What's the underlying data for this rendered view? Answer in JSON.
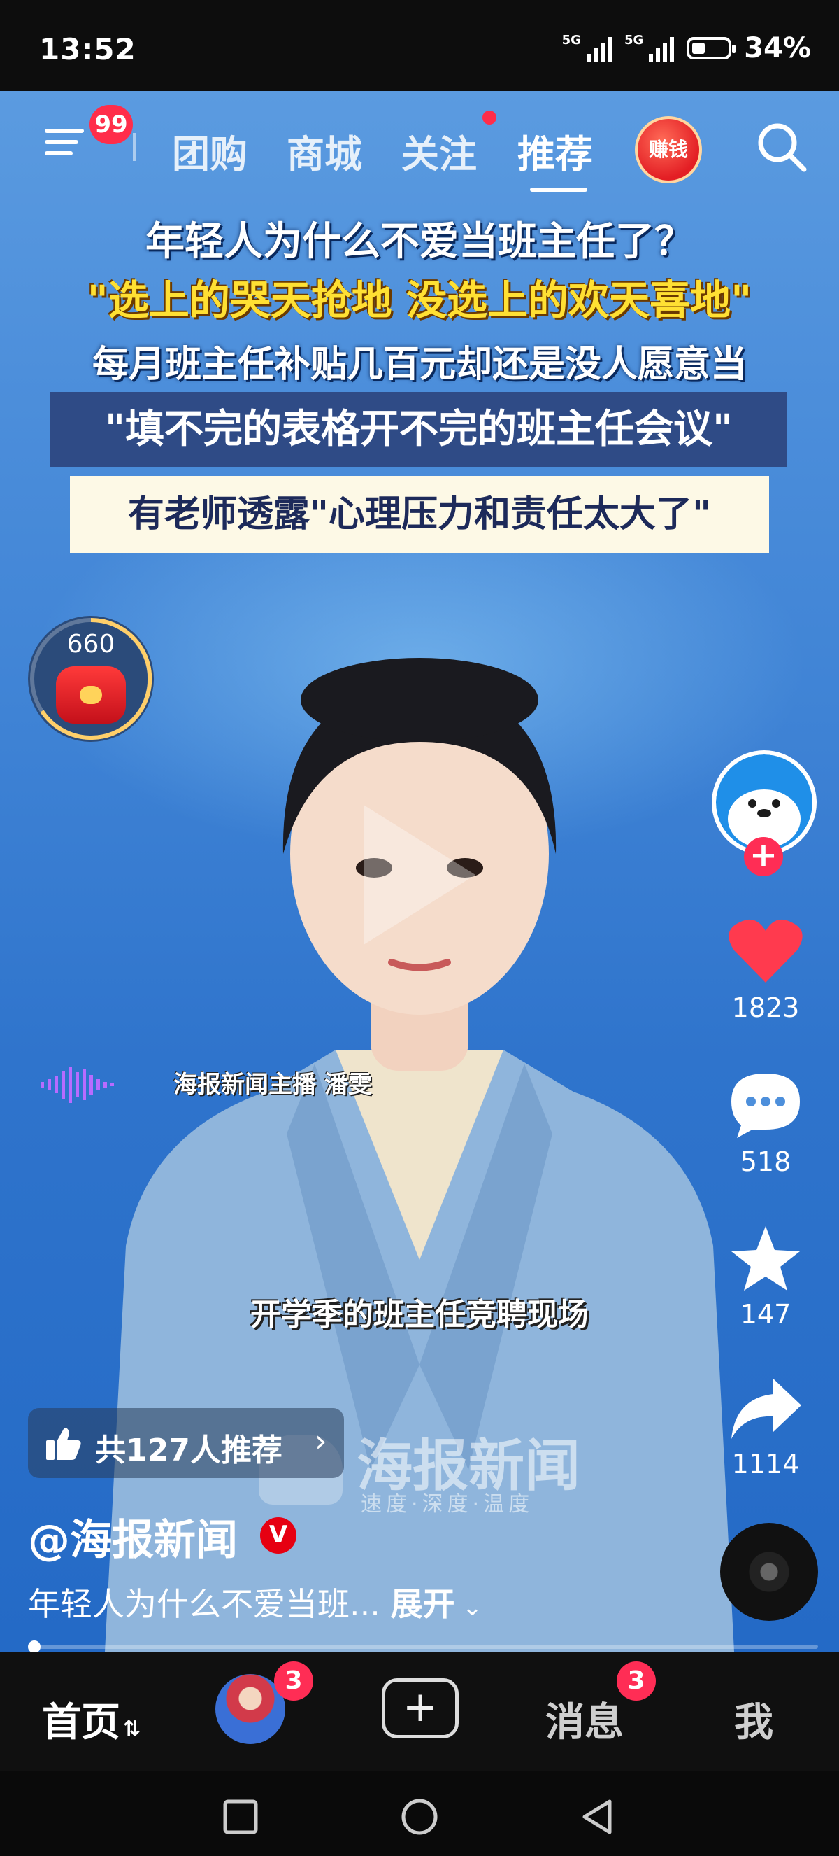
{
  "status_bar": {
    "time": "13:52",
    "network_1": "5G",
    "network_2": "5G",
    "battery": "34%",
    "battery_level": 0.34
  },
  "top_nav": {
    "menu_badge": "99",
    "tabs": [
      {
        "label": "团购",
        "active": false
      },
      {
        "label": "商城",
        "active": false
      },
      {
        "label": "关注",
        "active": false,
        "has_dot": true
      },
      {
        "label": "推荐",
        "active": true
      }
    ],
    "earn_label": "赚钱"
  },
  "video": {
    "headline_1": "年轻人为什么不爱当班主任了？",
    "headline_2": "\"选上的哭天抢地 没选上的欢天喜地\"",
    "headline_3": "每月班主任补贴几百元却还是没人愿意当",
    "headline_4": "\"填不完的表格开不完的班主任会议\"",
    "headline_5": "有老师透露\"心理压力和责任太大了\"",
    "anchor_caption": "海报新闻主播 潘雯",
    "subtitle": "开学季的班主任竞聘现场",
    "watermark_main": "海报新闻",
    "watermark_sub": "速度·深度·温度"
  },
  "coin_widget": {
    "value": "660"
  },
  "actions": {
    "likes": "1823",
    "comments": "518",
    "favorites": "147",
    "shares": "1114"
  },
  "recommend": {
    "label": "共127人推荐"
  },
  "author": {
    "name": "@海报新闻",
    "verified_mark": "V"
  },
  "description": {
    "text": "年轻人为什么不爱当班...",
    "expand": "展开"
  },
  "bottom_nav": {
    "home": "首页",
    "friends_badge": "3",
    "messages": "消息",
    "messages_badge": "3",
    "me": "我"
  },
  "colors": {
    "accent_red": "#ff2d55",
    "headline_yellow": "#ffe033",
    "video_blue": "#3f83d5"
  }
}
